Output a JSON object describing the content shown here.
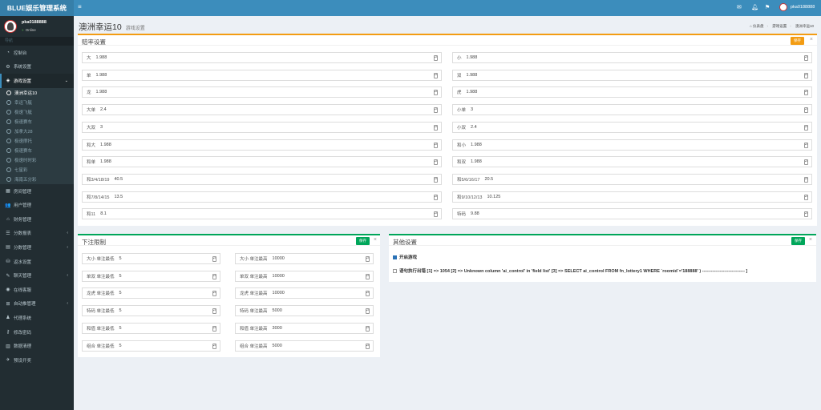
{
  "app": {
    "logo": "BLUE娱乐管理系统"
  },
  "user": {
    "name": "pka0188888",
    "status": "Online"
  },
  "sidebar": {
    "nav_header": "导航",
    "items": [
      {
        "label": "控制台",
        "icon": "dashboard-icon",
        "sym": "◔"
      },
      {
        "label": "系统设置",
        "icon": "gears-icon",
        "sym": "⚙"
      },
      {
        "label": "游戏设置",
        "icon": "gamepad-icon",
        "sym": "◈",
        "arrow": "⌄",
        "active": true
      }
    ],
    "sub_items": [
      "澳洲幸运10",
      "幸运飞艇",
      "极速飞艇",
      "极速赛车",
      "加拿大28",
      "极速摩托",
      "极速赛车",
      "极速时时彩",
      "七星彩",
      "海南五分彩"
    ],
    "items2": [
      {
        "label": "房间管理",
        "icon": "grid-icon",
        "sym": "▦"
      },
      {
        "label": "用户管理",
        "icon": "users-icon",
        "sym": "👥"
      },
      {
        "label": "财务管理",
        "icon": "bank-icon",
        "sym": "⌂"
      },
      {
        "label": "分数报表",
        "icon": "list-icon",
        "sym": "☰",
        "arrow": "‹"
      },
      {
        "label": "分数管理",
        "icon": "cash-icon",
        "sym": "▤",
        "arrow": "‹"
      },
      {
        "label": "返水设置",
        "icon": "coins-icon",
        "sym": "⛁"
      },
      {
        "label": "聊天管理",
        "icon": "chat-icon",
        "sym": "✎",
        "arrow": "‹"
      },
      {
        "label": "在线客服",
        "icon": "support-icon",
        "sym": "◉"
      },
      {
        "label": "自动推管理",
        "icon": "robot-icon",
        "sym": "⊞",
        "arrow": "‹"
      },
      {
        "label": "代理系统",
        "icon": "agent-icon",
        "sym": "♟"
      },
      {
        "label": "修改密码",
        "icon": "key-icon",
        "sym": "⚷"
      },
      {
        "label": "数据清理",
        "icon": "trash-icon",
        "sym": "▥"
      },
      {
        "label": "预设开奖",
        "icon": "gift-icon",
        "sym": "✈"
      }
    ]
  },
  "topbar": {
    "user": "pka0188888"
  },
  "page": {
    "title": "澳洲幸运10",
    "subtitle": "游戏设置",
    "breadcrumb": [
      "仪表盘",
      "游戏设置",
      "澳洲幸运10"
    ]
  },
  "odds": {
    "title": "赔率设置",
    "save": "保存",
    "close": "×",
    "left": [
      {
        "label": "大",
        "value": "1.988"
      },
      {
        "label": "单",
        "value": "1.988"
      },
      {
        "label": "龙",
        "value": "1.988"
      },
      {
        "label": "大单",
        "value": "2.4"
      },
      {
        "label": "大双",
        "value": "3"
      },
      {
        "label": "和大",
        "value": "1.988"
      },
      {
        "label": "和单",
        "value": "1.988"
      },
      {
        "label": "和3/4/18/19",
        "value": "40.5"
      },
      {
        "label": "和7/8/14/15",
        "value": "13.5"
      },
      {
        "label": "和11",
        "value": "8.1"
      }
    ],
    "right": [
      {
        "label": "小",
        "value": "1.988"
      },
      {
        "label": "双",
        "value": "1.988"
      },
      {
        "label": "虎",
        "value": "1.988"
      },
      {
        "label": "小单",
        "value": "3"
      },
      {
        "label": "小双",
        "value": "2.4"
      },
      {
        "label": "和小",
        "value": "1.988"
      },
      {
        "label": "和双",
        "value": "1.988"
      },
      {
        "label": "和5/6/16/17",
        "value": "20.5"
      },
      {
        "label": "和9/10/12/13",
        "value": "10.125"
      },
      {
        "label": "特码",
        "value": "9.88"
      }
    ]
  },
  "limits": {
    "title": "下注限制",
    "save": "保存",
    "close": "×",
    "rows": [
      {
        "min_label": "大小 单注最低",
        "min": "5",
        "max_label": "大小 单注最高",
        "max": "10000"
      },
      {
        "min_label": "单双 单注最低",
        "min": "5",
        "max_label": "单双 单注最高",
        "max": "10000"
      },
      {
        "min_label": "龙虎 单注最低",
        "min": "5",
        "max_label": "龙虎 单注最高",
        "max": "10000"
      },
      {
        "min_label": "特码 单注最低",
        "min": "5",
        "max_label": "特码 单注最高",
        "max": "5000"
      },
      {
        "min_label": "和值 单注最低",
        "min": "5",
        "max_label": "和值 单注最高",
        "max": "3000"
      },
      {
        "min_label": "组合 单注最低",
        "min": "5",
        "max_label": "组合 单注最高",
        "max": "5000"
      }
    ]
  },
  "other": {
    "title": "其他设置",
    "save": "保存",
    "close": "×",
    "open_game": "开启游戏",
    "error": "语句执行出错 [1] => 1054 [2] => Unknown column 'ai_control' in 'field list' [3] => SELECT ai_control FROM fn_lottery1 WHERE `roomid`='188888' ) ----------------------------- ]"
  },
  "colors": {
    "accent": "#3c8dbc",
    "warning": "#f39c12",
    "success": "#00a65a",
    "sidebar": "#222d32"
  }
}
